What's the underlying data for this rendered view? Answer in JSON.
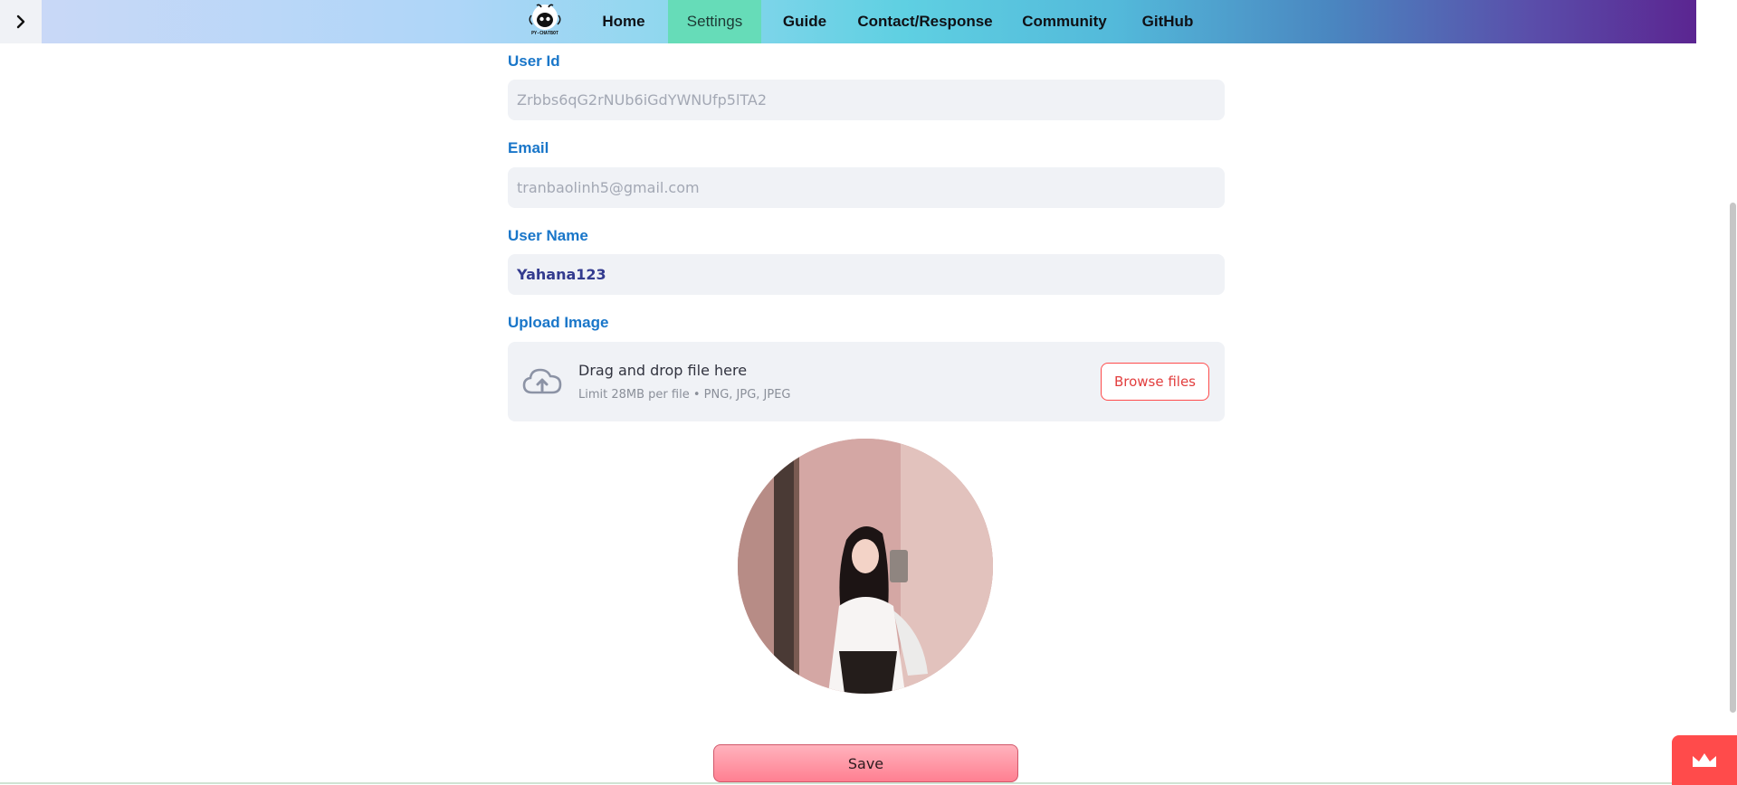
{
  "nav": {
    "logo_text": "PY-CHATBOT",
    "items": [
      "Home",
      "Settings",
      "Guide",
      "Contact/Response",
      "Community",
      "GitHub"
    ],
    "active": "Settings"
  },
  "form": {
    "user_id_label": "User Id",
    "user_id_value": "Zrbbs6qG2rNUb6iGdYWNUfp5lTA2",
    "email_label": "Email",
    "email_value": "tranbaolinh5@gmail.com",
    "username_label": "User Name",
    "username_value": "Yahana123",
    "upload_label": "Upload Image",
    "dropzone_title": "Drag and drop file here",
    "dropzone_limit": "Limit 28MB per file • PNG, JPG, JPEG",
    "browse_label": "Browse files",
    "save_label": "Save"
  },
  "colors": {
    "label": "#1976c9",
    "field_bg": "#f0f2f6",
    "accent": "#ff4b4b",
    "active_tab": "#66dcb8"
  },
  "icons": [
    "chevron-right-icon",
    "cloud-upload-icon",
    "crown-icon"
  ]
}
